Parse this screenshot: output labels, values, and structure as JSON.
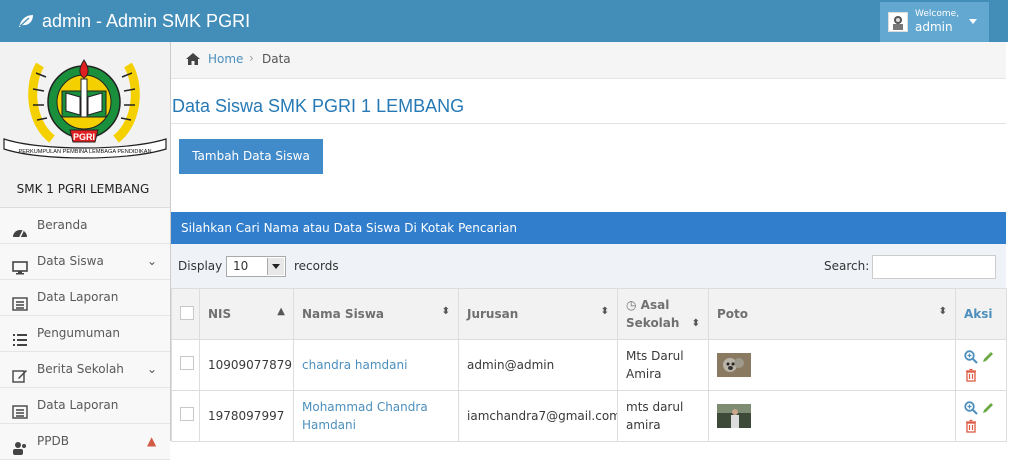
{
  "header": {
    "title": "admin - Admin SMK PGRI",
    "welcome": "Welcome,",
    "username": "admin"
  },
  "sidebar": {
    "logo_text": "PGRI",
    "logo_motto": "PERKUMPULAN PEMBINA LEMBAGA PENDIDIKAN",
    "school_name": "SMK 1 PGRI LEMBANG",
    "items": [
      {
        "label": "Beranda",
        "icon": "tachometer-icon"
      },
      {
        "label": "Data Siswa",
        "icon": "desktop-icon"
      },
      {
        "label": "Data Laporan",
        "icon": "list-alt-icon"
      },
      {
        "label": "Pengumuman",
        "icon": "list-icon"
      },
      {
        "label": "Berita Sekolah",
        "icon": "pencil-square-icon"
      },
      {
        "label": "Data Laporan",
        "icon": "list-alt-icon"
      },
      {
        "label": "PPDB",
        "icon": "users-icon"
      }
    ]
  },
  "breadcrumb": {
    "home": "Home",
    "current": "Data"
  },
  "page": {
    "title": "Data Siswa SMK PGRI 1 LEMBANG",
    "add_button": "Tambah Data Siswa"
  },
  "panel": {
    "header": "Silahkan Cari Nama atau Data Siswa Di Kotak Pencarian"
  },
  "table_controls": {
    "display_label": "Display",
    "page_size": "10",
    "records_label": "records",
    "search_label": "Search:"
  },
  "table": {
    "columns": [
      "NIS",
      "Nama Siswa",
      "Jurusan",
      "Asal Sekolah",
      "Poto",
      "Aksi"
    ],
    "rows": [
      {
        "nis": "10909077879",
        "nama": "chandra hamdani",
        "jurusan": "admin@admin",
        "asal": "Mts Darul Amira"
      },
      {
        "nis": "1978097997",
        "nama": "Mohammad Chandra Hamdani",
        "jurusan": "iamchandra7@gmail.com",
        "asal": "mts darul amira"
      }
    ]
  },
  "colors": {
    "navbar": "#438eb9",
    "user_box": "#62a8d1",
    "panel_header": "#307ecc",
    "button": "#428bca",
    "title": "#2679b5",
    "link": "#4c8fbd",
    "edit": "#69aa46",
    "delete": "#dd5a43"
  }
}
